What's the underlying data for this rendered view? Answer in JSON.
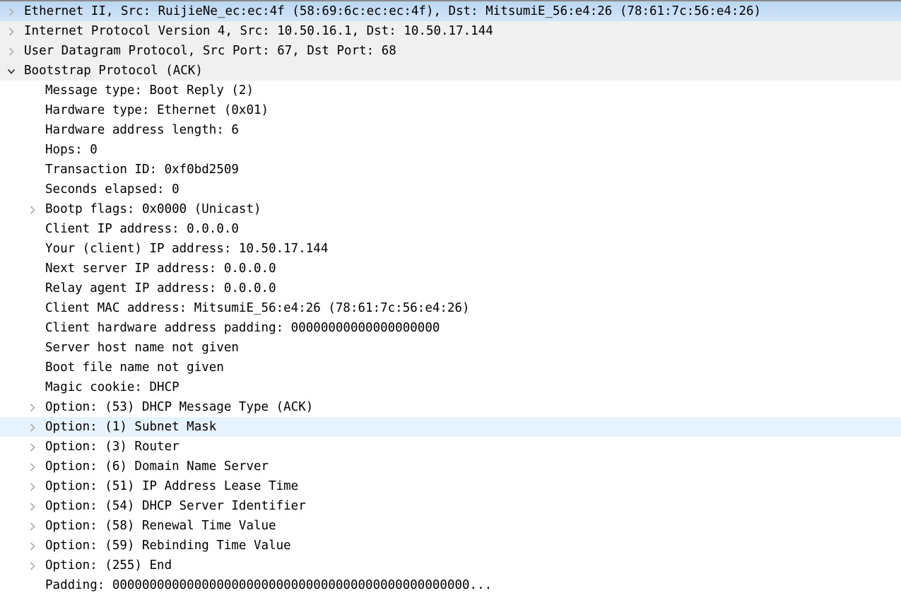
{
  "pane": {
    "name": "packet-details",
    "selected_row_index": 0,
    "highlight_row_index": 21,
    "colors": {
      "selected_row": "#c6ddf4",
      "highlight_row": "#e6f2fc",
      "protocol_row": "#f0f0f0",
      "text": "#000000",
      "twisty": "#a9a9a9",
      "top_border": "#8a8a8a"
    }
  },
  "rows": [
    {
      "level": 0,
      "twisty": "collapsed",
      "state": "selected",
      "text": "Ethernet II, Src: RuijieNe_ec:ec:4f (58:69:6c:ec:ec:4f), Dst: MitsumiE_56:e4:26 (78:61:7c:56:e4:26)"
    },
    {
      "level": 0,
      "twisty": "collapsed",
      "state": "normal",
      "text": "Internet Protocol Version 4, Src: 10.50.16.1, Dst: 10.50.17.144"
    },
    {
      "level": 0,
      "twisty": "collapsed",
      "state": "normal",
      "text": "User Datagram Protocol, Src Port: 67, Dst Port: 68"
    },
    {
      "level": 0,
      "twisty": "expanded",
      "state": "normal",
      "text": "Bootstrap Protocol (ACK)"
    },
    {
      "level": 1,
      "twisty": "none",
      "state": "normal",
      "text": "Message type: Boot Reply (2)"
    },
    {
      "level": 1,
      "twisty": "none",
      "state": "normal",
      "text": "Hardware type: Ethernet (0x01)"
    },
    {
      "level": 1,
      "twisty": "none",
      "state": "normal",
      "text": "Hardware address length: 6"
    },
    {
      "level": 1,
      "twisty": "none",
      "state": "normal",
      "text": "Hops: 0"
    },
    {
      "level": 1,
      "twisty": "none",
      "state": "normal",
      "text": "Transaction ID: 0xf0bd2509"
    },
    {
      "level": 1,
      "twisty": "none",
      "state": "normal",
      "text": "Seconds elapsed: 0"
    },
    {
      "level": 1,
      "twisty": "collapsed",
      "state": "normal",
      "text": "Bootp flags: 0x0000 (Unicast)"
    },
    {
      "level": 1,
      "twisty": "none",
      "state": "normal",
      "text": "Client IP address: 0.0.0.0"
    },
    {
      "level": 1,
      "twisty": "none",
      "state": "normal",
      "text": "Your (client) IP address: 10.50.17.144"
    },
    {
      "level": 1,
      "twisty": "none",
      "state": "normal",
      "text": "Next server IP address: 0.0.0.0"
    },
    {
      "level": 1,
      "twisty": "none",
      "state": "normal",
      "text": "Relay agent IP address: 0.0.0.0"
    },
    {
      "level": 1,
      "twisty": "none",
      "state": "normal",
      "text": "Client MAC address: MitsumiE_56:e4:26 (78:61:7c:56:e4:26)"
    },
    {
      "level": 1,
      "twisty": "none",
      "state": "normal",
      "text": "Client hardware address padding: 00000000000000000000"
    },
    {
      "level": 1,
      "twisty": "none",
      "state": "normal",
      "text": "Server host name not given"
    },
    {
      "level": 1,
      "twisty": "none",
      "state": "normal",
      "text": "Boot file name not given"
    },
    {
      "level": 1,
      "twisty": "none",
      "state": "normal",
      "text": "Magic cookie: DHCP"
    },
    {
      "level": 1,
      "twisty": "collapsed",
      "state": "normal",
      "text": "Option: (53) DHCP Message Type (ACK)"
    },
    {
      "level": 1,
      "twisty": "collapsed",
      "state": "highlight",
      "text": "Option: (1) Subnet Mask"
    },
    {
      "level": 1,
      "twisty": "collapsed",
      "state": "normal",
      "text": "Option: (3) Router"
    },
    {
      "level": 1,
      "twisty": "collapsed",
      "state": "normal",
      "text": "Option: (6) Domain Name Server"
    },
    {
      "level": 1,
      "twisty": "collapsed",
      "state": "normal",
      "text": "Option: (51) IP Address Lease Time"
    },
    {
      "level": 1,
      "twisty": "collapsed",
      "state": "normal",
      "text": "Option: (54) DHCP Server Identifier"
    },
    {
      "level": 1,
      "twisty": "collapsed",
      "state": "normal",
      "text": "Option: (58) Renewal Time Value"
    },
    {
      "level": 1,
      "twisty": "collapsed",
      "state": "normal",
      "text": "Option: (59) Rebinding Time Value"
    },
    {
      "level": 1,
      "twisty": "collapsed",
      "state": "normal",
      "text": "Option: (255) End"
    },
    {
      "level": 1,
      "twisty": "none",
      "state": "normal",
      "text": "Padding: 000000000000000000000000000000000000000000000000..."
    }
  ]
}
